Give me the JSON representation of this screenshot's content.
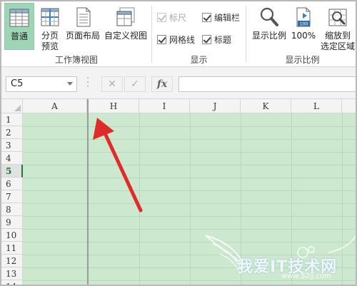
{
  "ribbon": {
    "workbook_views": {
      "group_label": "工作簿视图",
      "normal": "普通",
      "page_break_line1": "分页",
      "page_break_line2": "预览",
      "page_layout": "页面布局",
      "custom_views": "自定义视图"
    },
    "show": {
      "group_label": "显示",
      "ruler": "标尺",
      "formula_bar": "编辑栏",
      "gridlines": "网格线",
      "headings": "标题"
    },
    "zoom": {
      "group_label": "显示比例",
      "zoom": "显示比例",
      "zoom_100": "100%",
      "badge_100": "100",
      "zoom_selection_line1": "缩放到",
      "zoom_selection_line2": "选定区域"
    }
  },
  "formula_bar": {
    "name_box": "C5",
    "cancel": "✕",
    "enter": "✓",
    "fx": "fx",
    "value": ""
  },
  "grid": {
    "columns": [
      "A",
      "H",
      "I",
      "J",
      "K",
      "L"
    ],
    "rows": [
      "1",
      "2",
      "3",
      "4",
      "5",
      "6",
      "7",
      "8",
      "9",
      "10",
      "11",
      "12",
      "13",
      "14"
    ],
    "selected_row": "5"
  },
  "watermark": {
    "text": "我爱IT技术网",
    "url": "www.52ij.com"
  },
  "colors": {
    "sheet_bg": "#cce8cf",
    "active_button": "#9fd5b7",
    "arrow": "#e02b2b"
  }
}
